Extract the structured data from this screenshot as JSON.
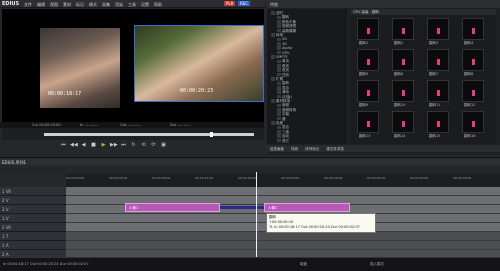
{
  "app": {
    "logo": "EDIUS",
    "menus": [
      "文件",
      "编辑",
      "视图",
      "素材",
      "标记",
      "模式",
      "采集",
      "渲染",
      "工具",
      "设置",
      "帮助"
    ],
    "pl_label": "PLR",
    "rec_label": "REC"
  },
  "preview": {
    "clip1_timecode": "00:00:18:17",
    "clip2_timecode": "00:00:20:23",
    "inout": [
      "Cur 00:00:20:00",
      "In --:--:--:--",
      "Out --:--:--:--",
      "Dur --:--:--:--"
    ]
  },
  "transport": [
    "⏮",
    "◀◀",
    "◀",
    "■",
    "▶",
    "▶▶",
    "⏭",
    "↻",
    "⟲",
    "⟳",
    "▣"
  ],
  "right_panel": {
    "title": "特效",
    "tree": [
      "逆时",
      "翻转",
      "颜色平衡",
      "视频滤镜",
      "高斯模糊",
      "转场",
      "2D",
      "3D",
      "Alpha",
      "GPU",
      "SMPTE",
      "单页",
      "卷页",
      "双页",
      "四页",
      "扩展",
      "旋转",
      "混合",
      "滑动",
      "(旧版)",
      "素材转场",
      "音频",
      "音频转场",
      "字幕",
      "键",
      "色度",
      "混合",
      "三维",
      "运动",
      "其它"
    ],
    "grid_header": "GPU 高级 - 翻转",
    "thumbs": [
      "翻转1",
      "翻转2",
      "翻转3",
      "翻转4",
      "翻转5",
      "翻转6",
      "翻转7",
      "翻转8",
      "翻转9",
      "翻转10",
      "翻转11",
      "翻转12",
      "翻转13",
      "翻转14",
      "翻转15",
      "翻转16"
    ],
    "tabs": [
      "信息面板",
      "特效",
      "序列标记",
      "源文件浏览"
    ]
  },
  "timeline": {
    "title": "EDIUS 序列1",
    "ruler_labels": [
      "00:00:00:00",
      "00:00:04:00",
      "00:00:08:00",
      "00:00:12:00",
      "00:00:16:00",
      "00:00:20:00",
      "00:00:24:00",
      "00:00:28:00",
      "00:00:32:00",
      "00:00:36:00"
    ],
    "tracks": [
      "1 VA",
      "2 V",
      "3 V",
      "1 V",
      "2 VA",
      "1 T",
      "1 A",
      "2 A"
    ],
    "clip1": "人像1",
    "clip2": "人像2",
    "tooltip": [
      "翻转",
      "+00:00:00:10",
      "TL In 00:00:18:17  Out 00:00:20:24  Dur 00:00:02:07"
    ]
  },
  "status": {
    "left": "In 00:00:18:17  Out 00:00:20:24  Dur 00:00:02:07",
    "mid": "磁盘",
    "right": "插入模式"
  },
  "colors": {
    "clip": "#b65ab6",
    "play": "#8cd44a",
    "rec_bg": "#2f5fd0",
    "plr_bg": "#c0392b"
  }
}
